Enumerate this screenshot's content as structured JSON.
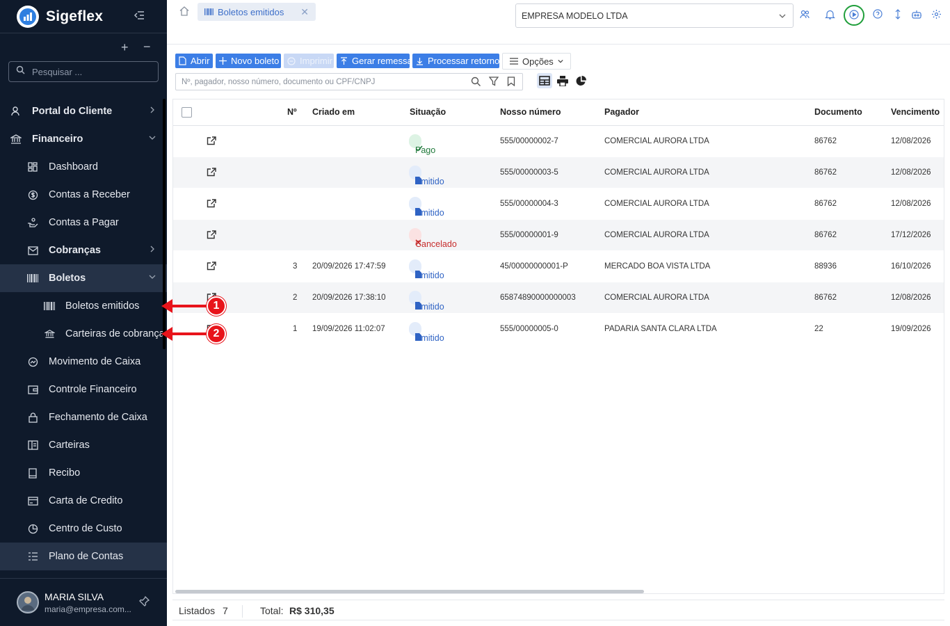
{
  "app": {
    "title": "Sigeflex"
  },
  "sidebar": {
    "search_placeholder": "Pesquisar ...",
    "items": [
      {
        "label": "Portal do Cliente"
      },
      {
        "label": "Financeiro"
      },
      {
        "label": "Dashboard"
      },
      {
        "label": "Contas a Receber"
      },
      {
        "label": "Contas a Pagar"
      },
      {
        "label": "Cobranças"
      },
      {
        "label": "Boletos"
      },
      {
        "label": "Boletos emitidos"
      },
      {
        "label": "Carteiras de cobrança"
      },
      {
        "label": "Movimento de Caixa"
      },
      {
        "label": "Controle Financeiro"
      },
      {
        "label": "Fechamento de Caixa"
      },
      {
        "label": "Carteiras"
      },
      {
        "label": "Recibo"
      },
      {
        "label": "Carta de Credito"
      },
      {
        "label": "Centro de Custo"
      },
      {
        "label": "Plano de Contas"
      }
    ],
    "user": {
      "name": "MARIA SILVA",
      "email": "maria@empresa.com..."
    }
  },
  "topbar": {
    "tab_label": "Boletos emitidos",
    "company": "EMPRESA MODELO LTDA"
  },
  "toolbar": {
    "open": "Abrir",
    "new": "Novo boleto",
    "print": "Imprimir",
    "remessa": "Gerar remessa",
    "retorno": "Processar retorno",
    "options": "Opções"
  },
  "search": {
    "placeholder": "Nº, pagador, nosso número, documento ou CPF/CNPJ"
  },
  "table": {
    "headers": {
      "num": "Nº",
      "created": "Criado em",
      "status": "Situação",
      "nosso": "Nosso número",
      "payer": "Pagador",
      "doc": "Documento",
      "due": "Vencimento"
    },
    "rows": [
      {
        "num": "",
        "created": "",
        "status": "Pago",
        "nosso": "555/00000002-7",
        "payer": "COMERCIAL AURORA LTDA",
        "doc": "86762",
        "due": "12/08/2026"
      },
      {
        "num": "",
        "created": "",
        "status": "Emitido",
        "nosso": "555/00000003-5",
        "payer": "COMERCIAL AURORA LTDA",
        "doc": "86762",
        "due": "12/08/2026"
      },
      {
        "num": "",
        "created": "",
        "status": "Emitido",
        "nosso": "555/00000004-3",
        "payer": "COMERCIAL AURORA LTDA",
        "doc": "86762",
        "due": "12/08/2026"
      },
      {
        "num": "",
        "created": "",
        "status": "Cancelado",
        "nosso": "555/00000001-9",
        "payer": "COMERCIAL AURORA LTDA",
        "doc": "86762",
        "due": "17/12/2026"
      },
      {
        "num": "3",
        "created": "20/09/2026 17:47:59",
        "status": "Emitido",
        "nosso": "45/00000000001-P",
        "payer": "MERCADO BOA VISTA LTDA",
        "doc": "88936",
        "due": "16/10/2026"
      },
      {
        "num": "2",
        "created": "20/09/2026 17:38:10",
        "status": "Emitido",
        "nosso": "65874890000000003",
        "payer": "COMERCIAL AURORA LTDA",
        "doc": "86762",
        "due": "12/08/2026"
      },
      {
        "num": "1",
        "created": "19/09/2026 11:02:07",
        "status": "Emitido",
        "nosso": "555/00000005-0",
        "payer": "PADARIA SANTA CLARA LTDA",
        "doc": "22",
        "due": "19/09/2026"
      }
    ]
  },
  "footer": {
    "listed_label": "Listados",
    "listed_count": "7",
    "total_label": "Total:",
    "total_value": "R$ 310,35"
  },
  "annotations": [
    "1",
    "2"
  ],
  "colors": {
    "sidebar_bg": "#0f1a2b",
    "accent": "#3c7ee6",
    "annotation": "#e8141b",
    "ring": "#1f9e3a"
  }
}
